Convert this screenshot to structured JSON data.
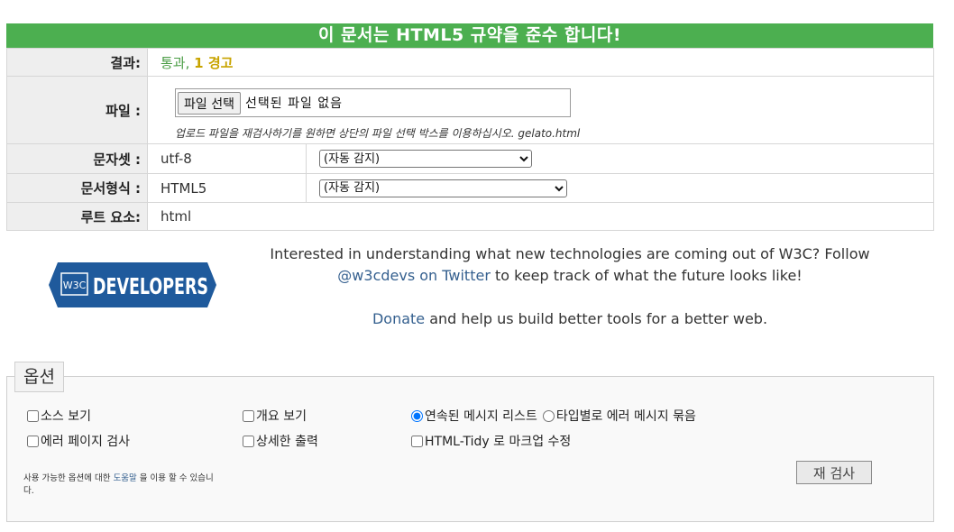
{
  "banner": {
    "title": "이 문서는 HTML5 규약을 준수 합니다!"
  },
  "results": {
    "result_label": "결과:",
    "result_pass": "통과,",
    "result_warn": "1 경고",
    "file_label": "파일 :",
    "file_button": "파일 선택",
    "file_status": "선택된 파일 없음",
    "file_hint": "업로드 파일을 재검사하기를 원하면 상단의 파일 선택 박스를 이용하십시오. gelato.html",
    "charset_label": "문자셋 :",
    "charset_value": "utf-8",
    "charset_select": "(자동 감지)",
    "doctype_label": "문서형식 :",
    "doctype_value": "HTML5",
    "doctype_select": "(자동 감지)",
    "root_label": "루트 요소:",
    "root_value": "html"
  },
  "promo": {
    "logo_text": "W3C DEVELOPERS",
    "line1_pre": "Interested in understanding what new technologies are coming out of W3C? Follow ",
    "line1_link": "@w3cdevs on Twitter",
    "line1_post": " to keep track of what the future looks like!",
    "line2_link": "Donate",
    "line2_post": " and help us build better tools for a better web."
  },
  "options": {
    "legend": "옵션",
    "show_source": "소스 보기",
    "error_pages": "에러 페이지 검사",
    "outline": "개요 보기",
    "verbose": "상세한 출력",
    "group_seq": "연속된 메시지 리스트",
    "group_type": "타입별로 에러 메시지 묶음",
    "tidy": "HTML-Tidy 로 마크업 수정",
    "help_pre": "사용 가능한 옵션에 대한 ",
    "help_link": "도움말",
    "help_post": " 을 이용 할 수 있습니다.",
    "recheck": "재 검사"
  },
  "colors": {
    "banner": "#4caf50",
    "pass": "#4a9d45",
    "warn": "#c8a400",
    "link": "#35608f",
    "logo": "#1f5a9c"
  }
}
